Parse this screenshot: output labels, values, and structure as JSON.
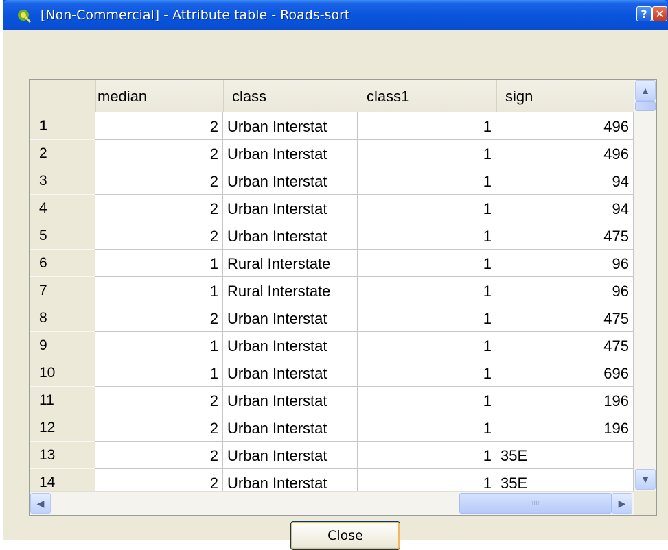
{
  "window": {
    "title": "[Non-Commercial] - Attribute table - Roads-sort",
    "help_label": "?",
    "close_label": "✕"
  },
  "table": {
    "columns": [
      "median",
      "class",
      "class1",
      "sign"
    ],
    "rows": [
      {
        "num": "1",
        "median": "2",
        "class": "Urban Interstat",
        "class1": "1",
        "sign": "496",
        "sign_align": "right"
      },
      {
        "num": "2",
        "median": "2",
        "class": "Urban Interstat",
        "class1": "1",
        "sign": "496",
        "sign_align": "right"
      },
      {
        "num": "3",
        "median": "2",
        "class": "Urban Interstat",
        "class1": "1",
        "sign": "94",
        "sign_align": "right"
      },
      {
        "num": "4",
        "median": "2",
        "class": "Urban Interstat",
        "class1": "1",
        "sign": "94",
        "sign_align": "right"
      },
      {
        "num": "5",
        "median": "2",
        "class": "Urban Interstat",
        "class1": "1",
        "sign": "475",
        "sign_align": "right"
      },
      {
        "num": "6",
        "median": "1",
        "class": "Rural Interstate",
        "class1": "1",
        "sign": "96",
        "sign_align": "right"
      },
      {
        "num": "7",
        "median": "1",
        "class": "Rural Interstate",
        "class1": "1",
        "sign": "96",
        "sign_align": "right"
      },
      {
        "num": "8",
        "median": "2",
        "class": "Urban Interstat",
        "class1": "1",
        "sign": "475",
        "sign_align": "right"
      },
      {
        "num": "9",
        "median": "1",
        "class": "Urban Interstat",
        "class1": "1",
        "sign": "475",
        "sign_align": "right"
      },
      {
        "num": "10",
        "median": "1",
        "class": "Urban Interstat",
        "class1": "1",
        "sign": "696",
        "sign_align": "right"
      },
      {
        "num": "11",
        "median": "2",
        "class": "Urban Interstat",
        "class1": "1",
        "sign": "196",
        "sign_align": "right"
      },
      {
        "num": "12",
        "median": "2",
        "class": "Urban Interstat",
        "class1": "1",
        "sign": "196",
        "sign_align": "right"
      },
      {
        "num": "13",
        "median": "2",
        "class": "Urban Interstat",
        "class1": "1",
        "sign": "35E",
        "sign_align": "left"
      },
      {
        "num": "14",
        "median": "2",
        "class": "Urban Interstat",
        "class1": "1",
        "sign": "35E",
        "sign_align": "left"
      }
    ]
  },
  "scroll": {
    "up_label": "▲",
    "down_label": "▼",
    "left_label": "◀",
    "right_label": "▶",
    "grip_label": "IIII"
  },
  "footer": {
    "close_button_label": "Close"
  }
}
